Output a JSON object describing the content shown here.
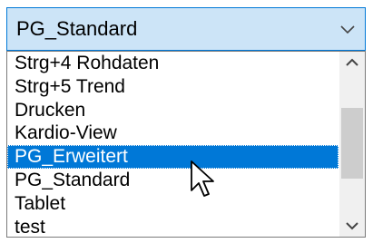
{
  "combo": {
    "selected_value": "PG_Standard",
    "dropdown_icon": "chevron-down-icon"
  },
  "list": {
    "items": [
      {
        "label": "Strg+4 Rohdaten",
        "selected": false
      },
      {
        "label": "Strg+5 Trend",
        "selected": false
      },
      {
        "label": "Drucken",
        "selected": false
      },
      {
        "label": "Kardio-View",
        "selected": false
      },
      {
        "label": "PG_Erweitert",
        "selected": true
      },
      {
        "label": "PG_Standard",
        "selected": false
      },
      {
        "label": "Tablet",
        "selected": false
      },
      {
        "label": "test",
        "selected": false
      }
    ],
    "scroll_up_icon": "chevron-up-icon",
    "scroll_down_icon": "chevron-down-icon"
  },
  "colors": {
    "field_background": "#cce4f7",
    "field_border": "#0078d7",
    "selection": "#0078d7",
    "scrollbar_track": "#f0f0f0",
    "scrollbar_thumb": "#cdcdcd"
  },
  "cursor": {
    "icon": "mouse-pointer-icon"
  }
}
